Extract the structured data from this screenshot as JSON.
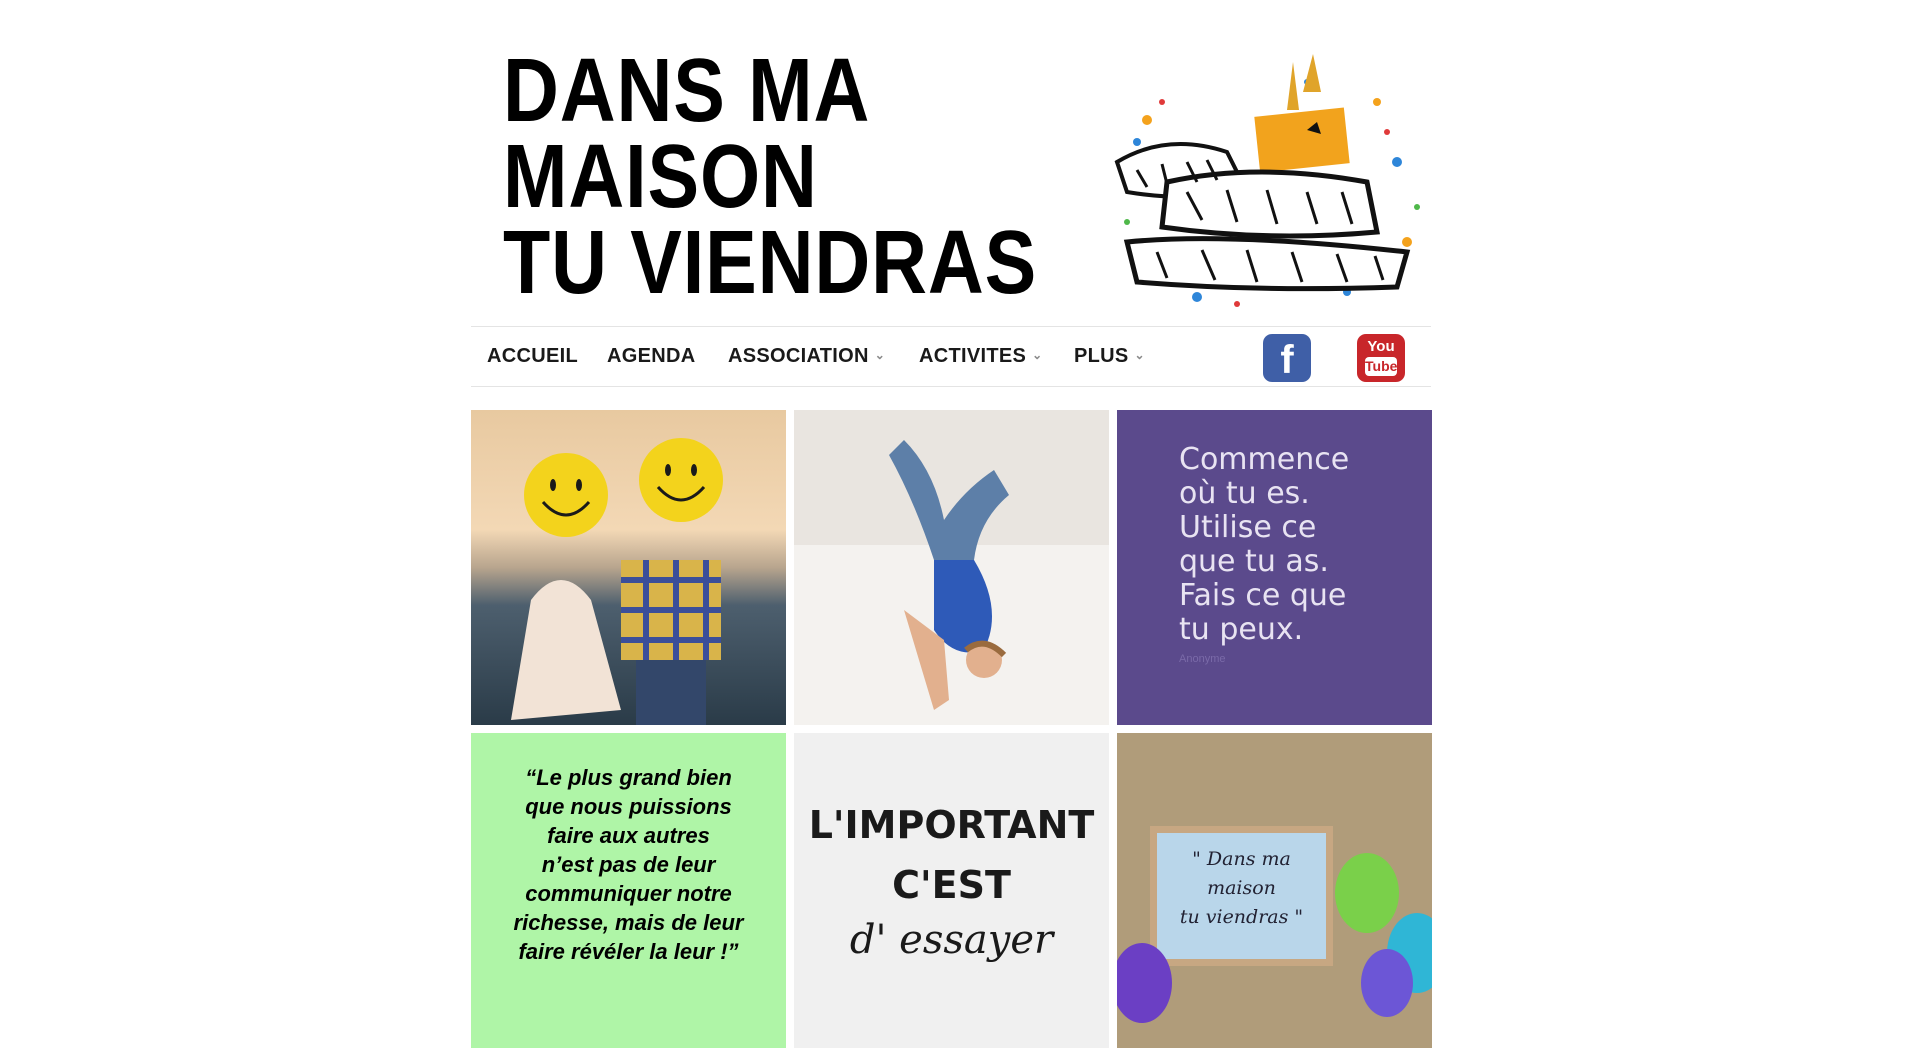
{
  "header": {
    "title_lines": [
      "DANS MA",
      "MAISON",
      "TU VIENDRAS"
    ],
    "logo_icon": "graffiti-logo"
  },
  "nav": {
    "items": [
      {
        "label": "ACCUEIL",
        "dropdown": false
      },
      {
        "label": "AGENDA",
        "dropdown": false
      },
      {
        "label": "ASSOCIATION",
        "dropdown": true
      },
      {
        "label": "ACTIVITES",
        "dropdown": true
      },
      {
        "label": "PLUS",
        "dropdown": true
      }
    ],
    "chevron": "⌄",
    "social": {
      "facebook_glyph": "f",
      "youtube_top": "You",
      "youtube_bottom": "Tube"
    }
  },
  "tiles": {
    "purple_quote": "Commence\noù tu es.\nUtilise ce\nque tu as.\nFais ce que\ntu peux.",
    "purple_author": "Anonyme",
    "green_quote": "“Le plus grand bien\nque nous puissions\nfaire aux autres\nn’est pas de leur\ncommuniquer notre\nrichesse, mais de leur\nfaire révéler la leur !”",
    "important_line1": "L'IMPORTANT",
    "important_line2": "C'EST",
    "important_line3": "d' essayer",
    "sign_text": "\" Dans ma\nmaison\ntu viendras \""
  },
  "colors": {
    "purple": "#5b4a8c",
    "green": "#aff5a7",
    "facebook": "#3f5fa7",
    "youtube": "#c8262a"
  }
}
